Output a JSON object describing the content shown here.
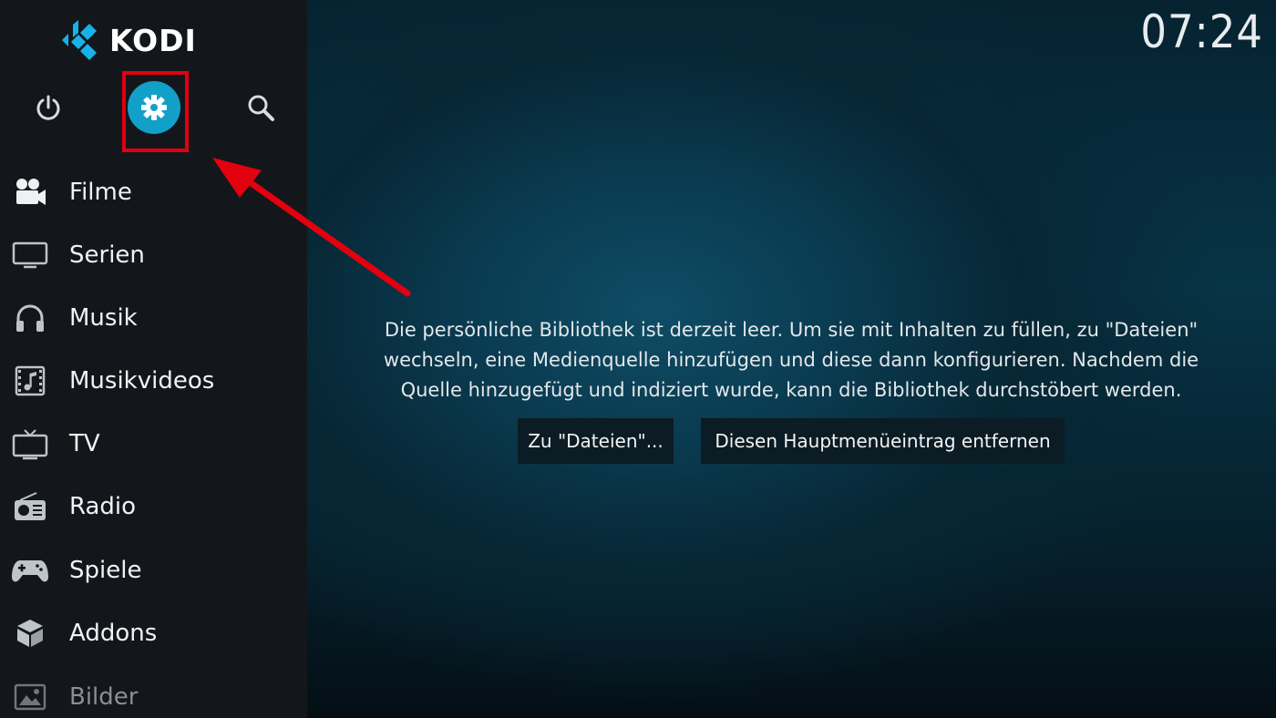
{
  "app": {
    "logo_text": "KODI"
  },
  "clock": "07:24",
  "top_buttons": {
    "power": "power-icon",
    "settings": "gear-icon",
    "search": "search-icon"
  },
  "menu": {
    "items": [
      {
        "label": "Filme",
        "icon": "movie-camera-icon"
      },
      {
        "label": "Serien",
        "icon": "monitor-icon"
      },
      {
        "label": "Musik",
        "icon": "headphones-icon"
      },
      {
        "label": "Musikvideos",
        "icon": "music-video-icon"
      },
      {
        "label": "TV",
        "icon": "tv-icon"
      },
      {
        "label": "Radio",
        "icon": "radio-icon"
      },
      {
        "label": "Spiele",
        "icon": "gamepad-icon"
      },
      {
        "label": "Addons",
        "icon": "addons-box-icon"
      },
      {
        "label": "Bilder",
        "icon": "pictures-icon"
      }
    ]
  },
  "main": {
    "message_lines": [
      "Die persönliche Bibliothek ist derzeit leer. Um sie mit Inhalten zu füllen, zu \"Dateien\"",
      "wechseln, eine Medienquelle hinzufügen und diese dann konfigurieren. Nachdem die",
      "Quelle hinzugefügt und indiziert wurde, kann die Bibliothek durchstöbert werden."
    ],
    "files_button": "Zu \"Dateien\"...",
    "remove_button": "Diesen Hauptmenüeintrag entfernen"
  },
  "annotation": {
    "highlight_color": "#e3000f"
  },
  "colors": {
    "accent": "#12a0c9",
    "sidebar": "#13171b"
  }
}
